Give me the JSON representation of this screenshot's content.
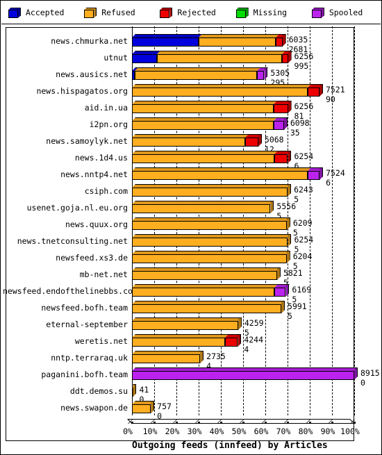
{
  "legend": {
    "items": [
      {
        "label": "Accepted",
        "color": "#0000dd",
        "icon": "cube-icon"
      },
      {
        "label": "Refused",
        "color": "#ffae20",
        "icon": "cube-icon"
      },
      {
        "label": "Rejected",
        "color": "#ee0000",
        "icon": "cube-icon"
      },
      {
        "label": "Missing",
        "color": "#00dd00",
        "icon": "cube-icon"
      },
      {
        "label": "Spooled",
        "color": "#bb22ee",
        "icon": "cube-icon"
      }
    ]
  },
  "chart_data": {
    "type": "bar",
    "orientation": "horizontal",
    "stacked": true,
    "title": "Outgoing feeds (innfeed) by Articles",
    "xlabel": "",
    "ylabel": "",
    "xlim": [
      0,
      100
    ],
    "xticks": [
      "0%",
      "10%",
      "20%",
      "30%",
      "40%",
      "50%",
      "60%",
      "70%",
      "80%",
      "90%",
      "100%"
    ],
    "grid": true,
    "legend_position": "top",
    "series": [
      {
        "name": "Accepted",
        "color": "#0000dd"
      },
      {
        "name": "Refused",
        "color": "#ffae20"
      },
      {
        "name": "Rejected",
        "color": "#ee0000"
      },
      {
        "name": "Missing",
        "color": "#00dd00"
      },
      {
        "name": "Spooled",
        "color": "#bb22ee"
      }
    ],
    "max_total": 8915,
    "categories": [
      "news.chmurka.net",
      "utnut",
      "news.ausics.net",
      "news.hispagatos.org",
      "aid.in.ua",
      "i2pn.org",
      "news.samoylyk.net",
      "news.1d4.us",
      "news.nntp4.net",
      "csiph.com",
      "usenet.goja.nl.eu.org",
      "news.quux.org",
      "news.tnetconsulting.net",
      "newsfeed.xs3.de",
      "mb-net.net",
      "newsfeed.endofthelinebbs.com",
      "newsfeed.bofh.team",
      "eternal-september",
      "weretis.net",
      "nntp.terraraq.uk",
      "paganini.bofh.team",
      "ddt.demos.su",
      "news.swapon.de"
    ],
    "rows": [
      {
        "label": "news.chmurka.net",
        "total": 6035,
        "second": 2681,
        "accepted": 2681,
        "refused": 3084,
        "rejected": 270,
        "missing": 0,
        "spooled": 0
      },
      {
        "label": "utnut",
        "total": 6256,
        "second": 995,
        "accepted": 995,
        "refused": 5011,
        "rejected": 250,
        "missing": 0,
        "spooled": 0
      },
      {
        "label": "news.ausics.net",
        "total": 5305,
        "second": 295,
        "accepted": 100,
        "refused": 4910,
        "rejected": 0,
        "missing": 0,
        "spooled": 295
      },
      {
        "label": "news.hispagatos.org",
        "total": 7521,
        "second": 90,
        "accepted": 0,
        "refused": 7041,
        "rejected": 480,
        "missing": 0,
        "spooled": 0
      },
      {
        "label": "aid.in.ua",
        "total": 6256,
        "second": 81,
        "accepted": 0,
        "refused": 5676,
        "rejected": 580,
        "missing": 0,
        "spooled": 0
      },
      {
        "label": "i2pn.org",
        "total": 6098,
        "second": 35,
        "accepted": 0,
        "refused": 5678,
        "rejected": 0,
        "missing": 0,
        "spooled": 420
      },
      {
        "label": "news.samoylyk.net",
        "total": 5068,
        "second": 12,
        "accepted": 0,
        "refused": 4528,
        "rejected": 540,
        "missing": 0,
        "spooled": 0
      },
      {
        "label": "news.1d4.us",
        "total": 6254,
        "second": 6,
        "accepted": 0,
        "refused": 5714,
        "rejected": 540,
        "missing": 0,
        "spooled": 0
      },
      {
        "label": "news.nntp4.net",
        "total": 7524,
        "second": 6,
        "accepted": 0,
        "refused": 7044,
        "rejected": 0,
        "missing": 0,
        "spooled": 480
      },
      {
        "label": "csiph.com",
        "total": 6243,
        "second": 5,
        "accepted": 0,
        "refused": 6243,
        "rejected": 0,
        "missing": 0,
        "spooled": 0
      },
      {
        "label": "usenet.goja.nl.eu.org",
        "total": 5556,
        "second": 5,
        "accepted": 0,
        "refused": 5556,
        "rejected": 0,
        "missing": 0,
        "spooled": 0
      },
      {
        "label": "news.quux.org",
        "total": 6209,
        "second": 5,
        "accepted": 0,
        "refused": 6209,
        "rejected": 0,
        "missing": 0,
        "spooled": 0
      },
      {
        "label": "news.tnetconsulting.net",
        "total": 6254,
        "second": 5,
        "accepted": 0,
        "refused": 6254,
        "rejected": 0,
        "missing": 0,
        "spooled": 0
      },
      {
        "label": "newsfeed.xs3.de",
        "total": 6204,
        "second": 5,
        "accepted": 0,
        "refused": 6204,
        "rejected": 0,
        "missing": 0,
        "spooled": 0
      },
      {
        "label": "mb-net.net",
        "total": 5821,
        "second": 5,
        "accepted": 0,
        "refused": 5821,
        "rejected": 0,
        "missing": 0,
        "spooled": 0
      },
      {
        "label": "newsfeed.endofthelinebbs.com",
        "total": 6169,
        "second": 5,
        "accepted": 0,
        "refused": 5709,
        "rejected": 0,
        "missing": 0,
        "spooled": 460
      },
      {
        "label": "newsfeed.bofh.team",
        "total": 5991,
        "second": 5,
        "accepted": 0,
        "refused": 5991,
        "rejected": 0,
        "missing": 0,
        "spooled": 0
      },
      {
        "label": "eternal-september",
        "total": 4259,
        "second": 5,
        "accepted": 0,
        "refused": 4259,
        "rejected": 0,
        "missing": 0,
        "spooled": 0
      },
      {
        "label": "weretis.net",
        "total": 4244,
        "second": 4,
        "accepted": 0,
        "refused": 3744,
        "rejected": 500,
        "missing": 0,
        "spooled": 0
      },
      {
        "label": "nntp.terraraq.uk",
        "total": 2735,
        "second": 4,
        "accepted": 0,
        "refused": 2735,
        "rejected": 0,
        "missing": 0,
        "spooled": 0
      },
      {
        "label": "paganini.bofh.team",
        "total": 8915,
        "second": 0,
        "accepted": 0,
        "refused": 0,
        "rejected": 0,
        "missing": 0,
        "spooled": 8915
      },
      {
        "label": "ddt.demos.su",
        "total": 41,
        "second": 0,
        "accepted": 0,
        "refused": 41,
        "rejected": 0,
        "missing": 0,
        "spooled": 0
      },
      {
        "label": "news.swapon.de",
        "total": 757,
        "second": 0,
        "accepted": 0,
        "refused": 757,
        "rejected": 0,
        "missing": 0,
        "spooled": 0
      }
    ]
  }
}
